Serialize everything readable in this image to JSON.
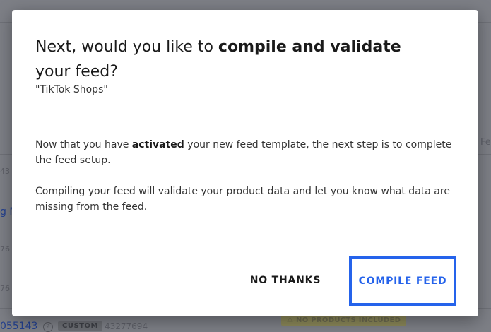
{
  "background": {
    "side_text": "Fe",
    "id_fragment_1": "43",
    "link_fragment": "g M",
    "id_fragment_2": "76",
    "id_fragment_3": "76",
    "row_link": "055143",
    "row_help": "?",
    "row_badge": "CUSTOM",
    "row_id": "43277694",
    "warning_badge": "NO PRODUCTS INCLUDED"
  },
  "modal": {
    "title_prefix": "Next, would you like to ",
    "title_bold": "compile and validate",
    "title_suffix": " your feed?",
    "subtitle": "\"TikTok Shops\"",
    "paragraph1_prefix": "Now that you have ",
    "paragraph1_bold": "activated",
    "paragraph1_suffix": " your new feed template, the next step is to complete the feed setup.",
    "paragraph2": "Compiling your feed will validate your product data and let you know what data are missing from the feed.",
    "no_thanks_label": "NO THANKS",
    "compile_label": "COMPILE FEED"
  },
  "colors": {
    "accent": "#2563eb",
    "overlay": "#7d7f86"
  }
}
